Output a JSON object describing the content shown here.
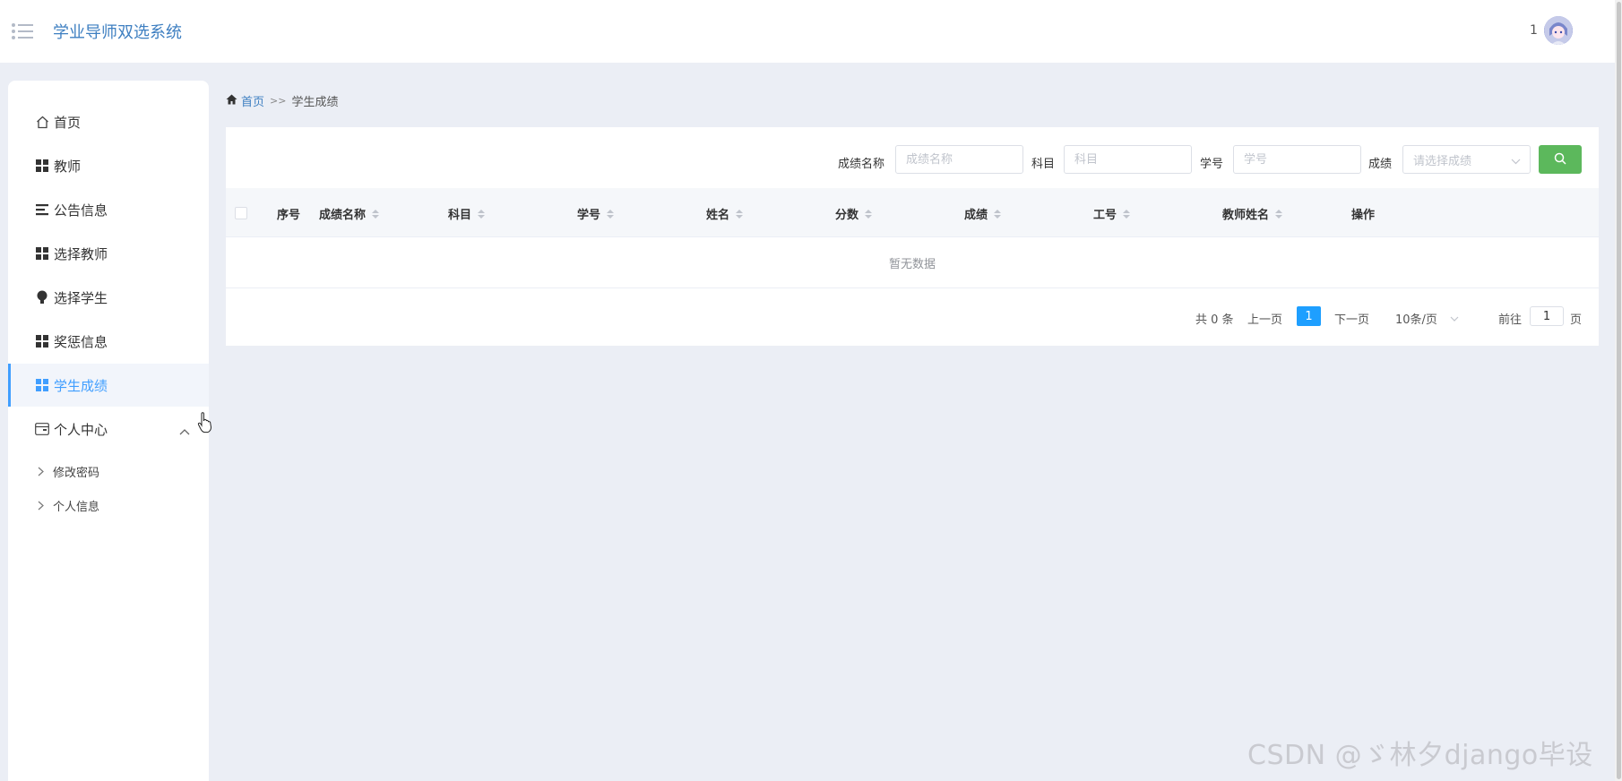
{
  "header": {
    "app_title": "学业导师双选系统",
    "user_name": "1"
  },
  "sidebar": {
    "items": [
      {
        "label": "首页",
        "icon": "home-icon"
      },
      {
        "label": "教师",
        "icon": "grid-icon"
      },
      {
        "label": "公告信息",
        "icon": "list-icon"
      },
      {
        "label": "选择教师",
        "icon": "grid-icon"
      },
      {
        "label": "选择学生",
        "icon": "bulb-icon"
      },
      {
        "label": "奖惩信息",
        "icon": "grid-icon"
      },
      {
        "label": "学生成绩",
        "icon": "grid-icon",
        "active": true
      },
      {
        "label": "个人中心",
        "icon": "wallet-icon",
        "expanded": true
      }
    ],
    "sub_items": [
      {
        "label": "修改密码"
      },
      {
        "label": "个人信息"
      }
    ]
  },
  "breadcrumb": {
    "home": "首页",
    "separator": ">>",
    "current": "学生成绩"
  },
  "search": {
    "fields": [
      {
        "label": "成绩名称",
        "placeholder": "成绩名称",
        "value": ""
      },
      {
        "label": "科目",
        "placeholder": "科目",
        "value": ""
      },
      {
        "label": "学号",
        "placeholder": "学号",
        "value": ""
      },
      {
        "label": "成绩",
        "placeholder": "请选择成绩",
        "value": ""
      }
    ]
  },
  "table": {
    "columns": [
      "序号",
      "成绩名称",
      "科目",
      "学号",
      "姓名",
      "分数",
      "成绩",
      "工号",
      "教师姓名",
      "操作"
    ],
    "rows": [],
    "empty_text": "暂无数据"
  },
  "pagination": {
    "total_text": "共 0 条",
    "prev": "上一页",
    "current_page": "1",
    "next": "下一页",
    "page_size": "10条/页",
    "goto_label": "前往",
    "goto_value": "1",
    "page_unit": "页"
  },
  "watermark": "CSDN @ゞ林夕django毕设",
  "colors": {
    "accent": "#409eff",
    "title_blue": "#3e7fc1",
    "search_button": "#5cb85c",
    "page_active": "#1e9fff",
    "background": "#ebeef5"
  }
}
